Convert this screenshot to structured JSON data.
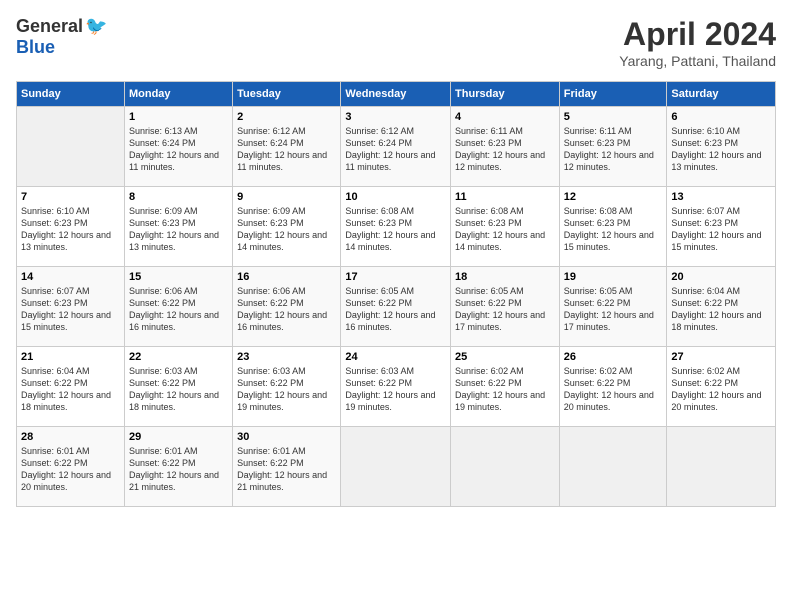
{
  "header": {
    "logo_general": "General",
    "logo_blue": "Blue",
    "title": "April 2024",
    "location": "Yarang, Pattani, Thailand"
  },
  "days_of_week": [
    "Sunday",
    "Monday",
    "Tuesday",
    "Wednesday",
    "Thursday",
    "Friday",
    "Saturday"
  ],
  "weeks": [
    [
      {
        "day": "",
        "sunrise": "",
        "sunset": "",
        "daylight": ""
      },
      {
        "day": "1",
        "sunrise": "Sunrise: 6:13 AM",
        "sunset": "Sunset: 6:24 PM",
        "daylight": "Daylight: 12 hours and 11 minutes."
      },
      {
        "day": "2",
        "sunrise": "Sunrise: 6:12 AM",
        "sunset": "Sunset: 6:24 PM",
        "daylight": "Daylight: 12 hours and 11 minutes."
      },
      {
        "day": "3",
        "sunrise": "Sunrise: 6:12 AM",
        "sunset": "Sunset: 6:24 PM",
        "daylight": "Daylight: 12 hours and 11 minutes."
      },
      {
        "day": "4",
        "sunrise": "Sunrise: 6:11 AM",
        "sunset": "Sunset: 6:23 PM",
        "daylight": "Daylight: 12 hours and 12 minutes."
      },
      {
        "day": "5",
        "sunrise": "Sunrise: 6:11 AM",
        "sunset": "Sunset: 6:23 PM",
        "daylight": "Daylight: 12 hours and 12 minutes."
      },
      {
        "day": "6",
        "sunrise": "Sunrise: 6:10 AM",
        "sunset": "Sunset: 6:23 PM",
        "daylight": "Daylight: 12 hours and 13 minutes."
      }
    ],
    [
      {
        "day": "7",
        "sunrise": "Sunrise: 6:10 AM",
        "sunset": "Sunset: 6:23 PM",
        "daylight": "Daylight: 12 hours and 13 minutes."
      },
      {
        "day": "8",
        "sunrise": "Sunrise: 6:09 AM",
        "sunset": "Sunset: 6:23 PM",
        "daylight": "Daylight: 12 hours and 13 minutes."
      },
      {
        "day": "9",
        "sunrise": "Sunrise: 6:09 AM",
        "sunset": "Sunset: 6:23 PM",
        "daylight": "Daylight: 12 hours and 14 minutes."
      },
      {
        "day": "10",
        "sunrise": "Sunrise: 6:08 AM",
        "sunset": "Sunset: 6:23 PM",
        "daylight": "Daylight: 12 hours and 14 minutes."
      },
      {
        "day": "11",
        "sunrise": "Sunrise: 6:08 AM",
        "sunset": "Sunset: 6:23 PM",
        "daylight": "Daylight: 12 hours and 14 minutes."
      },
      {
        "day": "12",
        "sunrise": "Sunrise: 6:08 AM",
        "sunset": "Sunset: 6:23 PM",
        "daylight": "Daylight: 12 hours and 15 minutes."
      },
      {
        "day": "13",
        "sunrise": "Sunrise: 6:07 AM",
        "sunset": "Sunset: 6:23 PM",
        "daylight": "Daylight: 12 hours and 15 minutes."
      }
    ],
    [
      {
        "day": "14",
        "sunrise": "Sunrise: 6:07 AM",
        "sunset": "Sunset: 6:23 PM",
        "daylight": "Daylight: 12 hours and 15 minutes."
      },
      {
        "day": "15",
        "sunrise": "Sunrise: 6:06 AM",
        "sunset": "Sunset: 6:22 PM",
        "daylight": "Daylight: 12 hours and 16 minutes."
      },
      {
        "day": "16",
        "sunrise": "Sunrise: 6:06 AM",
        "sunset": "Sunset: 6:22 PM",
        "daylight": "Daylight: 12 hours and 16 minutes."
      },
      {
        "day": "17",
        "sunrise": "Sunrise: 6:05 AM",
        "sunset": "Sunset: 6:22 PM",
        "daylight": "Daylight: 12 hours and 16 minutes."
      },
      {
        "day": "18",
        "sunrise": "Sunrise: 6:05 AM",
        "sunset": "Sunset: 6:22 PM",
        "daylight": "Daylight: 12 hours and 17 minutes."
      },
      {
        "day": "19",
        "sunrise": "Sunrise: 6:05 AM",
        "sunset": "Sunset: 6:22 PM",
        "daylight": "Daylight: 12 hours and 17 minutes."
      },
      {
        "day": "20",
        "sunrise": "Sunrise: 6:04 AM",
        "sunset": "Sunset: 6:22 PM",
        "daylight": "Daylight: 12 hours and 18 minutes."
      }
    ],
    [
      {
        "day": "21",
        "sunrise": "Sunrise: 6:04 AM",
        "sunset": "Sunset: 6:22 PM",
        "daylight": "Daylight: 12 hours and 18 minutes."
      },
      {
        "day": "22",
        "sunrise": "Sunrise: 6:03 AM",
        "sunset": "Sunset: 6:22 PM",
        "daylight": "Daylight: 12 hours and 18 minutes."
      },
      {
        "day": "23",
        "sunrise": "Sunrise: 6:03 AM",
        "sunset": "Sunset: 6:22 PM",
        "daylight": "Daylight: 12 hours and 19 minutes."
      },
      {
        "day": "24",
        "sunrise": "Sunrise: 6:03 AM",
        "sunset": "Sunset: 6:22 PM",
        "daylight": "Daylight: 12 hours and 19 minutes."
      },
      {
        "day": "25",
        "sunrise": "Sunrise: 6:02 AM",
        "sunset": "Sunset: 6:22 PM",
        "daylight": "Daylight: 12 hours and 19 minutes."
      },
      {
        "day": "26",
        "sunrise": "Sunrise: 6:02 AM",
        "sunset": "Sunset: 6:22 PM",
        "daylight": "Daylight: 12 hours and 20 minutes."
      },
      {
        "day": "27",
        "sunrise": "Sunrise: 6:02 AM",
        "sunset": "Sunset: 6:22 PM",
        "daylight": "Daylight: 12 hours and 20 minutes."
      }
    ],
    [
      {
        "day": "28",
        "sunrise": "Sunrise: 6:01 AM",
        "sunset": "Sunset: 6:22 PM",
        "daylight": "Daylight: 12 hours and 20 minutes."
      },
      {
        "day": "29",
        "sunrise": "Sunrise: 6:01 AM",
        "sunset": "Sunset: 6:22 PM",
        "daylight": "Daylight: 12 hours and 21 minutes."
      },
      {
        "day": "30",
        "sunrise": "Sunrise: 6:01 AM",
        "sunset": "Sunset: 6:22 PM",
        "daylight": "Daylight: 12 hours and 21 minutes."
      },
      {
        "day": "",
        "sunrise": "",
        "sunset": "",
        "daylight": ""
      },
      {
        "day": "",
        "sunrise": "",
        "sunset": "",
        "daylight": ""
      },
      {
        "day": "",
        "sunrise": "",
        "sunset": "",
        "daylight": ""
      },
      {
        "day": "",
        "sunrise": "",
        "sunset": "",
        "daylight": ""
      }
    ]
  ]
}
